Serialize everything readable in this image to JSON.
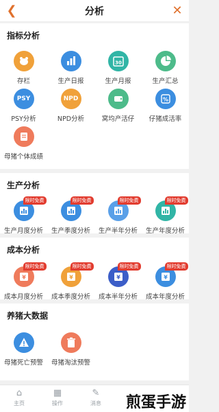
{
  "header": {
    "title": "分析"
  },
  "colors": {
    "accent": "#e0712d",
    "orange": "#f0a13a",
    "blue": "#3c8ee0",
    "teal": "#31b5a6",
    "green": "#4dbb8a",
    "pink": "#ef7b5c",
    "red_badge": "#e23c2f"
  },
  "sections": {
    "indicators": {
      "title": "指标分析",
      "items": [
        "存栏",
        "生产日报",
        "生产月报",
        "生产汇总",
        "PSY分析",
        "NPD分析",
        "窝均产活仔",
        "仔猪成活率",
        "母猪个体成绩"
      ],
      "icon_text": {
        "psy": "PSY",
        "npd": "NPD",
        "calendar_day": "30"
      }
    },
    "production": {
      "title": "生产分析",
      "badge": "限时免费",
      "items": [
        "生产月度分析",
        "生产季度分析",
        "生产半年分析",
        "生产年度分析"
      ]
    },
    "cost": {
      "title": "成本分析",
      "badge": "限时免费",
      "items": [
        "成本月度分析",
        "成本季度分析",
        "成本半年分析",
        "成本年度分析"
      ]
    },
    "bigdata": {
      "title": "养猪大数据",
      "items": [
        "母猪死亡预警",
        "母猪淘汰预警"
      ]
    }
  },
  "tabbar": {
    "items": [
      "主页",
      "操作",
      "消息"
    ]
  },
  "watermark": "煎蛋手游"
}
